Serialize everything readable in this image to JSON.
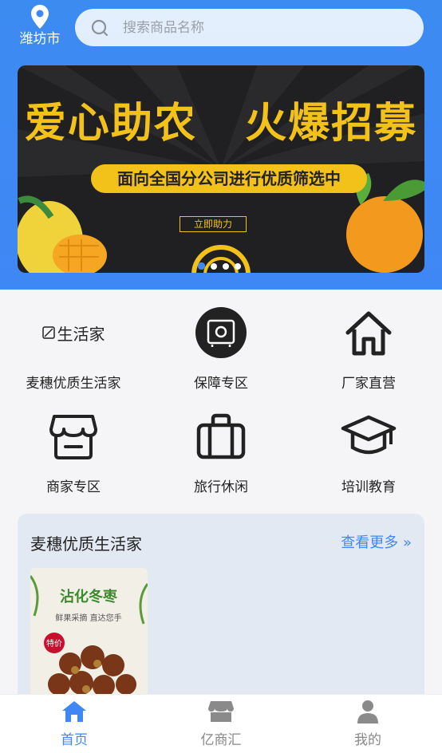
{
  "header": {
    "city": "潍坊市",
    "search_placeholder": "搜索商品名称"
  },
  "banner": {
    "title": "爱心助农   火爆招募",
    "subtitle": "面向全国分公司进行优质筛选中",
    "button": "立即助力",
    "page_count": 4,
    "active_index": 0
  },
  "categories": [
    {
      "label": "麦穗优质生活家",
      "icon": "life-home-logo-icon",
      "logo_text": "生活家"
    },
    {
      "label": "保障专区",
      "icon": "safe-icon"
    },
    {
      "label": "厂家直营",
      "icon": "home-icon"
    },
    {
      "label": "商家专区",
      "icon": "shop-icon"
    },
    {
      "label": "旅行休闲",
      "icon": "suitcase-icon"
    },
    {
      "label": "培训教育",
      "icon": "graduation-cap-icon"
    }
  ],
  "section": {
    "title": "麦穗优质生活家",
    "more": "查看更多",
    "product": {
      "title": "沾化冬枣",
      "caption": "鲜果采摘 直达您手",
      "badge": "特价"
    }
  },
  "tabbar": [
    {
      "label": "首页",
      "icon": "home-tab-icon",
      "active": true
    },
    {
      "label": "亿商汇",
      "icon": "store-tab-icon",
      "active": false
    },
    {
      "label": "我的",
      "icon": "user-tab-icon",
      "active": false
    }
  ],
  "colors": {
    "primary": "#3f87f5",
    "banner_yellow": "#f2c21a",
    "banner_dark": "#202022"
  }
}
